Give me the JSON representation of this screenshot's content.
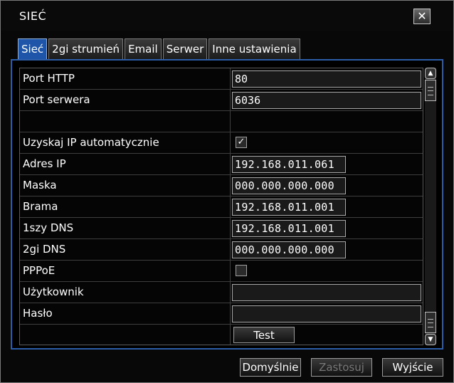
{
  "window": {
    "title": "SIEĆ",
    "close_label": "✕"
  },
  "tabs": [
    {
      "label": "Sieć",
      "active": true
    },
    {
      "label": "2gi strumień"
    },
    {
      "label": "Email"
    },
    {
      "label": "Serwer"
    },
    {
      "label": "Inne ustawienia"
    }
  ],
  "form": {
    "http_port": {
      "label": "Port HTTP",
      "value": "80"
    },
    "server_port": {
      "label": "Port serwera",
      "value": "6036"
    },
    "auto_ip": {
      "label": "Uzyskaj IP automatycznie",
      "checked": true,
      "mark": "✓"
    },
    "ip_address": {
      "label": "Adres IP",
      "value": "192.168.011.061"
    },
    "mask": {
      "label": "Maska",
      "value": "000.000.000.000"
    },
    "gateway": {
      "label": "Brama",
      "value": "192.168.011.001"
    },
    "dns1": {
      "label": "1szy DNS",
      "value": "192.168.011.001"
    },
    "dns2": {
      "label": "2gi DNS",
      "value": "000.000.000.000"
    },
    "pppoe": {
      "label": "PPPoE",
      "checked": false
    },
    "user": {
      "label": "Użytkownik",
      "value": ""
    },
    "password": {
      "label": "Hasło",
      "value": ""
    },
    "test_label": "Test"
  },
  "scrollbar": {
    "up": "▲",
    "down": "▼"
  },
  "footer": {
    "default_label": "Domyślnie",
    "apply_label": "Zastosuj",
    "exit_label": "Wyjście"
  },
  "colors": {
    "active_tab": "#1e55a8",
    "panel_border": "#2c5da8"
  }
}
